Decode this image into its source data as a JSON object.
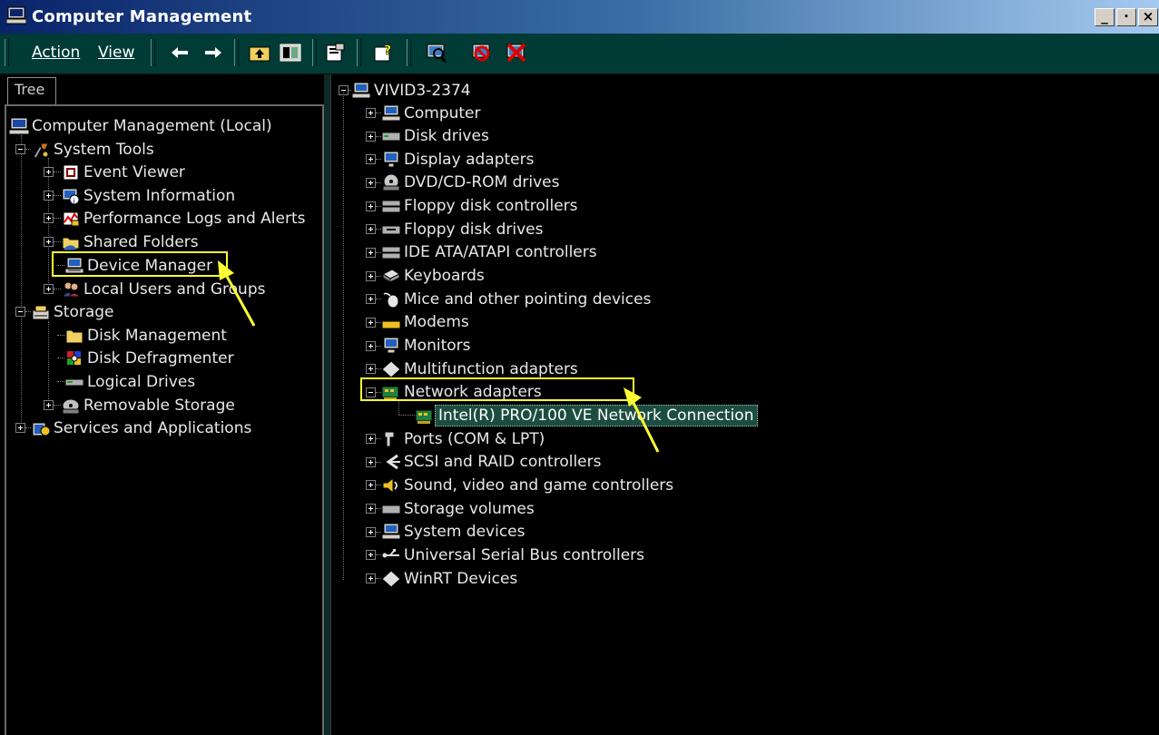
{
  "window": {
    "title": "Computer Management",
    "controls": [
      "_",
      "·",
      "×"
    ]
  },
  "menu": {
    "action": "Action",
    "view": "View"
  },
  "toolbar_icons": [
    "back-icon",
    "forward-icon",
    "up-folder-icon",
    "show-hide-tree-icon",
    "properties-icon",
    "help-icon",
    "scan-hardware-icon",
    "disable-device-icon",
    "uninstall-device-icon"
  ],
  "tab": {
    "label": "Tree"
  },
  "left_tree": {
    "root": "Computer Management (Local)",
    "system_tools": "System Tools",
    "event_viewer": "Event Viewer",
    "system_information": "System Information",
    "performance_logs": "Performance Logs and Alerts",
    "shared_folders": "Shared Folders",
    "device_manager": "Device Manager",
    "local_users": "Local Users and Groups",
    "storage": "Storage",
    "disk_management": "Disk Management",
    "disk_defragmenter": "Disk Defragmenter",
    "logical_drives": "Logical Drives",
    "removable_storage": "Removable Storage",
    "services_apps": "Services and Applications"
  },
  "right_tree": {
    "root": "VIVID3-2374",
    "categories": [
      "Computer",
      "Disk drives",
      "Display adapters",
      "DVD/CD-ROM drives",
      "Floppy disk controllers",
      "Floppy disk drives",
      "IDE ATA/ATAPI controllers",
      "Keyboards",
      "Mice and other pointing devices",
      "Modems",
      "Monitors",
      "Multifunction adapters",
      "Network adapters",
      "Intel(R) PRO/100 VE Network Connection",
      "Ports (COM & LPT)",
      "SCSI and RAID controllers",
      "Sound, video and game controllers",
      "Storage volumes",
      "System devices",
      "Universal Serial Bus controllers",
      "WinRT Devices"
    ]
  },
  "colors": {
    "highlight": "#ffff33",
    "selection": "#1c4d40",
    "toolbar": "#003b36",
    "titlebar": "#0a246a"
  }
}
